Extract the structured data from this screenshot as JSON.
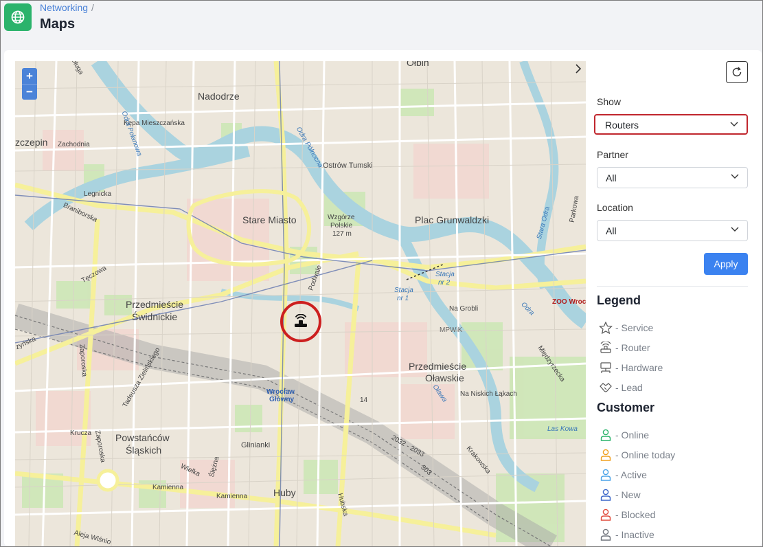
{
  "breadcrumb": {
    "parent": "Networking",
    "separator": "/"
  },
  "page": {
    "title": "Maps"
  },
  "map": {
    "labels": {
      "dluga": "Długa",
      "nadodrze": "Nadodrze",
      "olbin": "Ołbin",
      "kepa": "Kępa Mieszczańska",
      "odra_polanowa": "Odra Połanowa",
      "szczepin": "zczepin",
      "zachodnia": "Zachodnia",
      "odra_polnocna": "Odra Północna",
      "ostrow": "Ostrów Tumski",
      "legnicka": "Legnicka",
      "braniborska": "Braniborska",
      "stare_miasto": "Stare Miasto",
      "wzgorze_1": "Wzgórze",
      "wzgorze_2": "Polskie",
      "wzgorze_3": "127 m",
      "plac": "Plac Grunwaldzki",
      "stara_odra": "Stara Odra",
      "parkowa": "Parkowa",
      "teczowa": "Tęczowa",
      "podwale": "Podwale",
      "stacja2_a": "Stacja",
      "stacja2_b": "nr 2",
      "stacja1_a": "Stacja",
      "stacja1_b": "nr 1",
      "na_grobli": "Na Grobli",
      "zoo": "ZOO Wroc",
      "odra": "Odra",
      "przed_swid_1": "Przedmieście",
      "przed_swid_2": "Świdnickie",
      "mpwik": "MPWiK",
      "miedzyrzecka": "Międzyrzecka",
      "zynska": "zyńska",
      "zaporoska_1": "Zaporoska",
      "zielinskiego": "Tadeusza Zielińskiego",
      "wroclaw_glowny_1": "Wrocław",
      "wroclaw_glowny_2": "Główny",
      "przed_olaw_1": "Przedmieście",
      "przed_olaw_2": "Oławskie",
      "olawa": "Oława",
      "na_niskich": "Na Niskich Łąkach",
      "n14": "14",
      "krucza": "Krucza",
      "zaporoska_2": "Zaporoska",
      "powst_1": "Powstańców",
      "powst_2": "Śląskich",
      "glinianki": "Glinianki",
      "laskowa": "Las Kowa",
      "krakowska": "Krakowska",
      "wielka": "Wielka",
      "slezna": "Ślężna",
      "kamienna1": "Kamienna",
      "kamienna2": "Kamienna",
      "huby": "Huby",
      "hubska": "Hubska",
      "aleja": "Aleja Wiśnio",
      "n303": "303",
      "n2032": "2032 - 2033"
    }
  },
  "zoom": {
    "in": "+",
    "out": "−"
  },
  "filters": {
    "show": {
      "label": "Show",
      "value": "Routers"
    },
    "partner": {
      "label": "Partner",
      "value": "All"
    },
    "location": {
      "label": "Location",
      "value": "All"
    },
    "apply": "Apply"
  },
  "legend": {
    "title": "Legend",
    "items": [
      {
        "icon": "star-icon",
        "label": "- Service"
      },
      {
        "icon": "router-icon",
        "label": "- Router"
      },
      {
        "icon": "hardware-icon",
        "label": "- Hardware"
      },
      {
        "icon": "lead-icon",
        "label": "- Lead"
      }
    ]
  },
  "customer": {
    "title": "Customer",
    "items": [
      {
        "label": "- Online",
        "color": "#2bb36b"
      },
      {
        "label": "- Online today",
        "color": "#f0a020"
      },
      {
        "label": "- Active",
        "color": "#4ba3e8"
      },
      {
        "label": "- New",
        "color": "#3a66c8"
      },
      {
        "label": "- Blocked",
        "color": "#e04b3b"
      },
      {
        "label": "- Inactive",
        "color": "#6f747c"
      }
    ]
  }
}
